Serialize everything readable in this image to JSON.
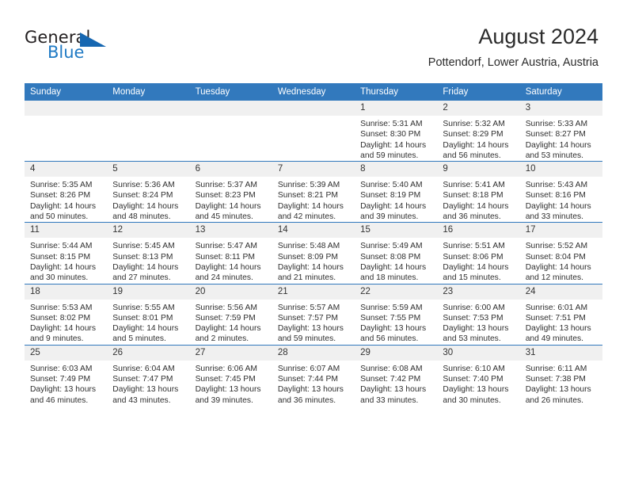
{
  "logo": {
    "word_top": "General",
    "word_bottom": "Blue",
    "triangle_color": "#1667b1",
    "blue_text_color": "#1f7ac4"
  },
  "header": {
    "title": "August 2024",
    "location": "Pottendorf, Lower Austria, Austria"
  },
  "theme": {
    "header_band": "#3279bd",
    "daynum_band": "#f0f0f0",
    "text": "#2f2f2f"
  },
  "weekday_headers": [
    "Sunday",
    "Monday",
    "Tuesday",
    "Wednesday",
    "Thursday",
    "Friday",
    "Saturday"
  ],
  "weeks": [
    [
      {
        "day": "",
        "empty": true,
        "sunrise": "",
        "sunset": "",
        "daylight_line1": "",
        "daylight_line2": ""
      },
      {
        "day": "",
        "empty": true,
        "sunrise": "",
        "sunset": "",
        "daylight_line1": "",
        "daylight_line2": ""
      },
      {
        "day": "",
        "empty": true,
        "sunrise": "",
        "sunset": "",
        "daylight_line1": "",
        "daylight_line2": ""
      },
      {
        "day": "",
        "empty": true,
        "sunrise": "",
        "sunset": "",
        "daylight_line1": "",
        "daylight_line2": ""
      },
      {
        "day": "1",
        "sunrise": "Sunrise: 5:31 AM",
        "sunset": "Sunset: 8:30 PM",
        "daylight_line1": "Daylight: 14 hours",
        "daylight_line2": "and 59 minutes."
      },
      {
        "day": "2",
        "sunrise": "Sunrise: 5:32 AM",
        "sunset": "Sunset: 8:29 PM",
        "daylight_line1": "Daylight: 14 hours",
        "daylight_line2": "and 56 minutes."
      },
      {
        "day": "3",
        "sunrise": "Sunrise: 5:33 AM",
        "sunset": "Sunset: 8:27 PM",
        "daylight_line1": "Daylight: 14 hours",
        "daylight_line2": "and 53 minutes."
      }
    ],
    [
      {
        "day": "4",
        "sunrise": "Sunrise: 5:35 AM",
        "sunset": "Sunset: 8:26 PM",
        "daylight_line1": "Daylight: 14 hours",
        "daylight_line2": "and 50 minutes."
      },
      {
        "day": "5",
        "sunrise": "Sunrise: 5:36 AM",
        "sunset": "Sunset: 8:24 PM",
        "daylight_line1": "Daylight: 14 hours",
        "daylight_line2": "and 48 minutes."
      },
      {
        "day": "6",
        "sunrise": "Sunrise: 5:37 AM",
        "sunset": "Sunset: 8:23 PM",
        "daylight_line1": "Daylight: 14 hours",
        "daylight_line2": "and 45 minutes."
      },
      {
        "day": "7",
        "sunrise": "Sunrise: 5:39 AM",
        "sunset": "Sunset: 8:21 PM",
        "daylight_line1": "Daylight: 14 hours",
        "daylight_line2": "and 42 minutes."
      },
      {
        "day": "8",
        "sunrise": "Sunrise: 5:40 AM",
        "sunset": "Sunset: 8:19 PM",
        "daylight_line1": "Daylight: 14 hours",
        "daylight_line2": "and 39 minutes."
      },
      {
        "day": "9",
        "sunrise": "Sunrise: 5:41 AM",
        "sunset": "Sunset: 8:18 PM",
        "daylight_line1": "Daylight: 14 hours",
        "daylight_line2": "and 36 minutes."
      },
      {
        "day": "10",
        "sunrise": "Sunrise: 5:43 AM",
        "sunset": "Sunset: 8:16 PM",
        "daylight_line1": "Daylight: 14 hours",
        "daylight_line2": "and 33 minutes."
      }
    ],
    [
      {
        "day": "11",
        "sunrise": "Sunrise: 5:44 AM",
        "sunset": "Sunset: 8:15 PM",
        "daylight_line1": "Daylight: 14 hours",
        "daylight_line2": "and 30 minutes."
      },
      {
        "day": "12",
        "sunrise": "Sunrise: 5:45 AM",
        "sunset": "Sunset: 8:13 PM",
        "daylight_line1": "Daylight: 14 hours",
        "daylight_line2": "and 27 minutes."
      },
      {
        "day": "13",
        "sunrise": "Sunrise: 5:47 AM",
        "sunset": "Sunset: 8:11 PM",
        "daylight_line1": "Daylight: 14 hours",
        "daylight_line2": "and 24 minutes."
      },
      {
        "day": "14",
        "sunrise": "Sunrise: 5:48 AM",
        "sunset": "Sunset: 8:09 PM",
        "daylight_line1": "Daylight: 14 hours",
        "daylight_line2": "and 21 minutes."
      },
      {
        "day": "15",
        "sunrise": "Sunrise: 5:49 AM",
        "sunset": "Sunset: 8:08 PM",
        "daylight_line1": "Daylight: 14 hours",
        "daylight_line2": "and 18 minutes."
      },
      {
        "day": "16",
        "sunrise": "Sunrise: 5:51 AM",
        "sunset": "Sunset: 8:06 PM",
        "daylight_line1": "Daylight: 14 hours",
        "daylight_line2": "and 15 minutes."
      },
      {
        "day": "17",
        "sunrise": "Sunrise: 5:52 AM",
        "sunset": "Sunset: 8:04 PM",
        "daylight_line1": "Daylight: 14 hours",
        "daylight_line2": "and 12 minutes."
      }
    ],
    [
      {
        "day": "18",
        "sunrise": "Sunrise: 5:53 AM",
        "sunset": "Sunset: 8:02 PM",
        "daylight_line1": "Daylight: 14 hours",
        "daylight_line2": "and 9 minutes."
      },
      {
        "day": "19",
        "sunrise": "Sunrise: 5:55 AM",
        "sunset": "Sunset: 8:01 PM",
        "daylight_line1": "Daylight: 14 hours",
        "daylight_line2": "and 5 minutes."
      },
      {
        "day": "20",
        "sunrise": "Sunrise: 5:56 AM",
        "sunset": "Sunset: 7:59 PM",
        "daylight_line1": "Daylight: 14 hours",
        "daylight_line2": "and 2 minutes."
      },
      {
        "day": "21",
        "sunrise": "Sunrise: 5:57 AM",
        "sunset": "Sunset: 7:57 PM",
        "daylight_line1": "Daylight: 13 hours",
        "daylight_line2": "and 59 minutes."
      },
      {
        "day": "22",
        "sunrise": "Sunrise: 5:59 AM",
        "sunset": "Sunset: 7:55 PM",
        "daylight_line1": "Daylight: 13 hours",
        "daylight_line2": "and 56 minutes."
      },
      {
        "day": "23",
        "sunrise": "Sunrise: 6:00 AM",
        "sunset": "Sunset: 7:53 PM",
        "daylight_line1": "Daylight: 13 hours",
        "daylight_line2": "and 53 minutes."
      },
      {
        "day": "24",
        "sunrise": "Sunrise: 6:01 AM",
        "sunset": "Sunset: 7:51 PM",
        "daylight_line1": "Daylight: 13 hours",
        "daylight_line2": "and 49 minutes."
      }
    ],
    [
      {
        "day": "25",
        "sunrise": "Sunrise: 6:03 AM",
        "sunset": "Sunset: 7:49 PM",
        "daylight_line1": "Daylight: 13 hours",
        "daylight_line2": "and 46 minutes."
      },
      {
        "day": "26",
        "sunrise": "Sunrise: 6:04 AM",
        "sunset": "Sunset: 7:47 PM",
        "daylight_line1": "Daylight: 13 hours",
        "daylight_line2": "and 43 minutes."
      },
      {
        "day": "27",
        "sunrise": "Sunrise: 6:06 AM",
        "sunset": "Sunset: 7:45 PM",
        "daylight_line1": "Daylight: 13 hours",
        "daylight_line2": "and 39 minutes."
      },
      {
        "day": "28",
        "sunrise": "Sunrise: 6:07 AM",
        "sunset": "Sunset: 7:44 PM",
        "daylight_line1": "Daylight: 13 hours",
        "daylight_line2": "and 36 minutes."
      },
      {
        "day": "29",
        "sunrise": "Sunrise: 6:08 AM",
        "sunset": "Sunset: 7:42 PM",
        "daylight_line1": "Daylight: 13 hours",
        "daylight_line2": "and 33 minutes."
      },
      {
        "day": "30",
        "sunrise": "Sunrise: 6:10 AM",
        "sunset": "Sunset: 7:40 PM",
        "daylight_line1": "Daylight: 13 hours",
        "daylight_line2": "and 30 minutes."
      },
      {
        "day": "31",
        "sunrise": "Sunrise: 6:11 AM",
        "sunset": "Sunset: 7:38 PM",
        "daylight_line1": "Daylight: 13 hours",
        "daylight_line2": "and 26 minutes."
      }
    ]
  ]
}
